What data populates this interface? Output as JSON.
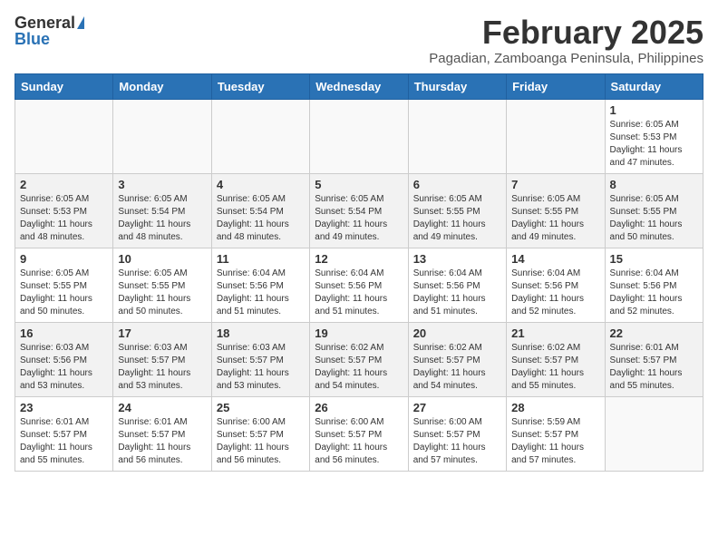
{
  "header": {
    "logo_general": "General",
    "logo_blue": "Blue",
    "month": "February 2025",
    "location": "Pagadian, Zamboanga Peninsula, Philippines"
  },
  "columns": [
    "Sunday",
    "Monday",
    "Tuesday",
    "Wednesday",
    "Thursday",
    "Friday",
    "Saturday"
  ],
  "weeks": [
    {
      "shaded": false,
      "days": [
        {
          "num": "",
          "info": ""
        },
        {
          "num": "",
          "info": ""
        },
        {
          "num": "",
          "info": ""
        },
        {
          "num": "",
          "info": ""
        },
        {
          "num": "",
          "info": ""
        },
        {
          "num": "",
          "info": ""
        },
        {
          "num": "1",
          "info": "Sunrise: 6:05 AM\nSunset: 5:53 PM\nDaylight: 11 hours and 47 minutes."
        }
      ]
    },
    {
      "shaded": true,
      "days": [
        {
          "num": "2",
          "info": "Sunrise: 6:05 AM\nSunset: 5:53 PM\nDaylight: 11 hours and 48 minutes."
        },
        {
          "num": "3",
          "info": "Sunrise: 6:05 AM\nSunset: 5:54 PM\nDaylight: 11 hours and 48 minutes."
        },
        {
          "num": "4",
          "info": "Sunrise: 6:05 AM\nSunset: 5:54 PM\nDaylight: 11 hours and 48 minutes."
        },
        {
          "num": "5",
          "info": "Sunrise: 6:05 AM\nSunset: 5:54 PM\nDaylight: 11 hours and 49 minutes."
        },
        {
          "num": "6",
          "info": "Sunrise: 6:05 AM\nSunset: 5:55 PM\nDaylight: 11 hours and 49 minutes."
        },
        {
          "num": "7",
          "info": "Sunrise: 6:05 AM\nSunset: 5:55 PM\nDaylight: 11 hours and 49 minutes."
        },
        {
          "num": "8",
          "info": "Sunrise: 6:05 AM\nSunset: 5:55 PM\nDaylight: 11 hours and 50 minutes."
        }
      ]
    },
    {
      "shaded": false,
      "days": [
        {
          "num": "9",
          "info": "Sunrise: 6:05 AM\nSunset: 5:55 PM\nDaylight: 11 hours and 50 minutes."
        },
        {
          "num": "10",
          "info": "Sunrise: 6:05 AM\nSunset: 5:55 PM\nDaylight: 11 hours and 50 minutes."
        },
        {
          "num": "11",
          "info": "Sunrise: 6:04 AM\nSunset: 5:56 PM\nDaylight: 11 hours and 51 minutes."
        },
        {
          "num": "12",
          "info": "Sunrise: 6:04 AM\nSunset: 5:56 PM\nDaylight: 11 hours and 51 minutes."
        },
        {
          "num": "13",
          "info": "Sunrise: 6:04 AM\nSunset: 5:56 PM\nDaylight: 11 hours and 51 minutes."
        },
        {
          "num": "14",
          "info": "Sunrise: 6:04 AM\nSunset: 5:56 PM\nDaylight: 11 hours and 52 minutes."
        },
        {
          "num": "15",
          "info": "Sunrise: 6:04 AM\nSunset: 5:56 PM\nDaylight: 11 hours and 52 minutes."
        }
      ]
    },
    {
      "shaded": true,
      "days": [
        {
          "num": "16",
          "info": "Sunrise: 6:03 AM\nSunset: 5:56 PM\nDaylight: 11 hours and 53 minutes."
        },
        {
          "num": "17",
          "info": "Sunrise: 6:03 AM\nSunset: 5:57 PM\nDaylight: 11 hours and 53 minutes."
        },
        {
          "num": "18",
          "info": "Sunrise: 6:03 AM\nSunset: 5:57 PM\nDaylight: 11 hours and 53 minutes."
        },
        {
          "num": "19",
          "info": "Sunrise: 6:02 AM\nSunset: 5:57 PM\nDaylight: 11 hours and 54 minutes."
        },
        {
          "num": "20",
          "info": "Sunrise: 6:02 AM\nSunset: 5:57 PM\nDaylight: 11 hours and 54 minutes."
        },
        {
          "num": "21",
          "info": "Sunrise: 6:02 AM\nSunset: 5:57 PM\nDaylight: 11 hours and 55 minutes."
        },
        {
          "num": "22",
          "info": "Sunrise: 6:01 AM\nSunset: 5:57 PM\nDaylight: 11 hours and 55 minutes."
        }
      ]
    },
    {
      "shaded": false,
      "days": [
        {
          "num": "23",
          "info": "Sunrise: 6:01 AM\nSunset: 5:57 PM\nDaylight: 11 hours and 55 minutes."
        },
        {
          "num": "24",
          "info": "Sunrise: 6:01 AM\nSunset: 5:57 PM\nDaylight: 11 hours and 56 minutes."
        },
        {
          "num": "25",
          "info": "Sunrise: 6:00 AM\nSunset: 5:57 PM\nDaylight: 11 hours and 56 minutes."
        },
        {
          "num": "26",
          "info": "Sunrise: 6:00 AM\nSunset: 5:57 PM\nDaylight: 11 hours and 56 minutes."
        },
        {
          "num": "27",
          "info": "Sunrise: 6:00 AM\nSunset: 5:57 PM\nDaylight: 11 hours and 57 minutes."
        },
        {
          "num": "28",
          "info": "Sunrise: 5:59 AM\nSunset: 5:57 PM\nDaylight: 11 hours and 57 minutes."
        },
        {
          "num": "",
          "info": ""
        }
      ]
    }
  ]
}
